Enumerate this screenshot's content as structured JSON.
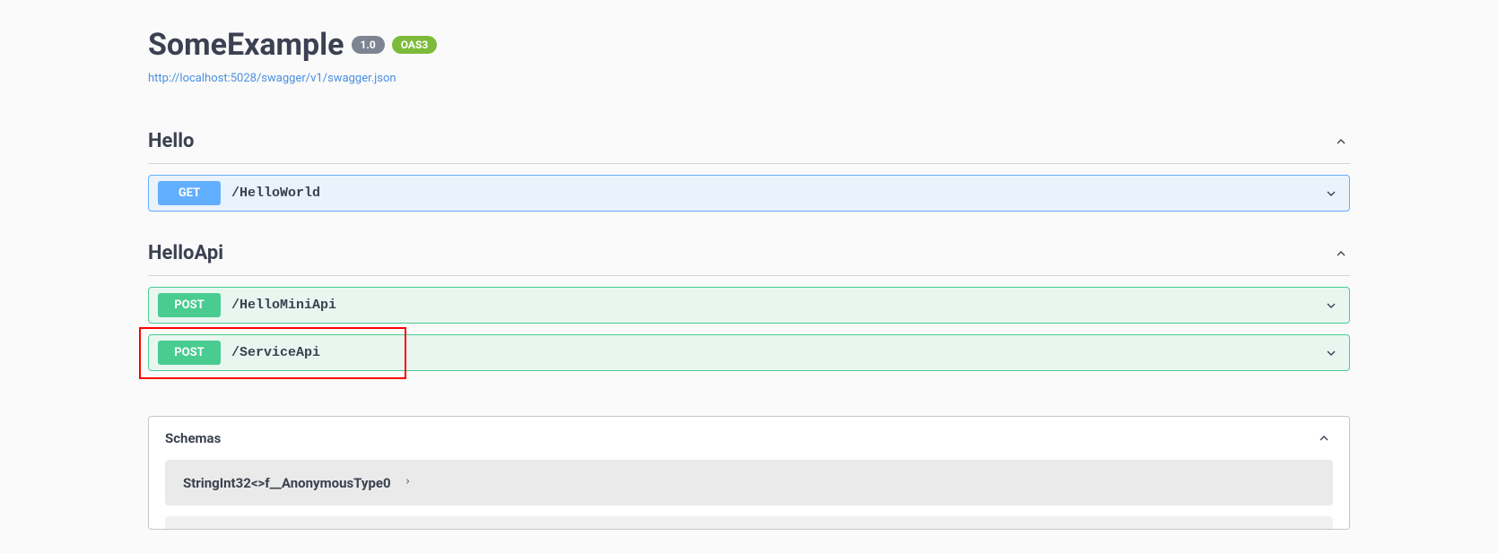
{
  "header": {
    "title": "SomeExample",
    "version": "1.0",
    "oas_badge": "OAS3",
    "url": "http://localhost:5028/swagger/v1/swagger.json"
  },
  "tags": [
    {
      "name": "Hello",
      "operations": [
        {
          "method": "GET",
          "path": "/HelloWorld"
        }
      ]
    },
    {
      "name": "HelloApi",
      "operations": [
        {
          "method": "POST",
          "path": "/HelloMiniApi"
        },
        {
          "method": "POST",
          "path": "/ServiceApi",
          "highlighted": true
        }
      ]
    }
  ],
  "schemas": {
    "heading": "Schemas",
    "items": [
      {
        "name": "StringInt32<>f__AnonymousType0"
      }
    ]
  }
}
